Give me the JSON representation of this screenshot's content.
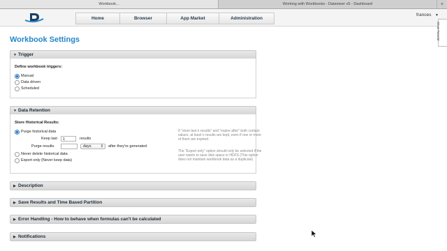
{
  "browser": {
    "tabs": [
      {
        "title": "Workbook...",
        "active": true
      },
      {
        "title": "Working with Workbooks - Datameer v5 - Dashboard",
        "active": false
      }
    ],
    "new_tab": "+"
  },
  "header": {
    "nav": [
      "Home",
      "Browser",
      "App Market",
      "Administration"
    ],
    "user": "frances",
    "user_caret": "▼",
    "side_tab": "Show Tutorial"
  },
  "page": {
    "title": "Workbook Settings"
  },
  "trigger": {
    "heading": "Trigger",
    "label": "Define workbook triggers:",
    "options": [
      "Manual",
      "Data driven",
      "Scheduled"
    ],
    "selected": "Manual"
  },
  "retention": {
    "heading": "Data Retention",
    "label": "Store Historical Results:",
    "purge_option": "Purge historical data",
    "keep_last_label": "Keep last",
    "keep_last_value": "1",
    "keep_last_unit": "results",
    "purge_results_label": "Purge results",
    "purge_results_value": "",
    "purge_unit": "days",
    "purge_suffix": "after they're generated",
    "never_delete": "Never delete historical data",
    "export_only": "Export only (Never keep data)",
    "note1": "If \"store last n results\" and \"expire after\" both contain values, at least n results are kept, even if one or more of them are expired.",
    "note2": "The \"Export only\" option should only be selected if the user wants to save disk space in HDFS (This option does not maintain workbook data as a duplicate)"
  },
  "collapsed_sections": [
    "Description",
    "Save Results and Time Based Partition",
    "Error Handling - How to behave when formulas can't be calculated",
    "Notifications"
  ],
  "colors": {
    "accent": "#2486c7",
    "radio_selected": "#2b6fb8"
  },
  "icons": {
    "expanded": "triangle-down",
    "collapsed": "triangle-right"
  }
}
